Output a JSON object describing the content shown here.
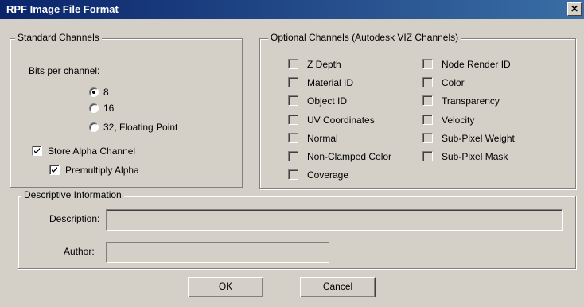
{
  "window": {
    "title": "RPF Image File Format",
    "close_glyph": "✕"
  },
  "standard": {
    "group_label": "Standard Channels",
    "bits_label": "Bits per channel:",
    "radios": [
      {
        "label": "8",
        "selected": true
      },
      {
        "label": "16",
        "selected": false
      },
      {
        "label": "32, Floating Point",
        "selected": false
      }
    ],
    "store_alpha": {
      "label": "Store Alpha Channel",
      "checked": true
    },
    "premultiply": {
      "label": "Premultiply Alpha",
      "checked": true
    }
  },
  "optional": {
    "group_label": "Optional Channels (Autodesk VIZ Channels)",
    "left": [
      "Z Depth",
      "Material ID",
      "Object ID",
      "UV Coordinates",
      "Normal",
      "Non-Clamped Color",
      "Coverage"
    ],
    "right": [
      "Node Render ID",
      "Color",
      "Transparency",
      "Velocity",
      "Sub-Pixel Weight",
      "Sub-Pixel Mask"
    ]
  },
  "descriptive": {
    "group_label": "Descriptive Information",
    "description_label": "Description:",
    "description_value": "",
    "author_label": "Author:",
    "author_value": ""
  },
  "buttons": {
    "ok": "OK",
    "cancel": "Cancel"
  }
}
